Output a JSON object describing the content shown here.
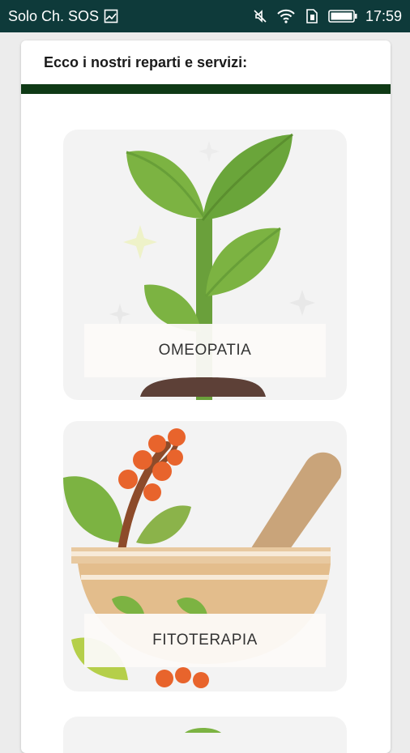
{
  "status_bar": {
    "carrier": "Solo Ch. SOS",
    "time": "17:59",
    "icons": [
      "image-icon",
      "mute-icon",
      "wifi-icon",
      "sim-icon",
      "battery-icon"
    ]
  },
  "card": {
    "header": "Ecco i nostri reparti e servizi:",
    "colors": {
      "divider": "#0f3a16",
      "status_bar": "#0e3a3a"
    },
    "services": [
      {
        "label": "OMEOPATIA",
        "icon": "plant-sprout-icon"
      },
      {
        "label": "FITOTERAPIA",
        "icon": "mortar-herbs-icon"
      }
    ]
  }
}
